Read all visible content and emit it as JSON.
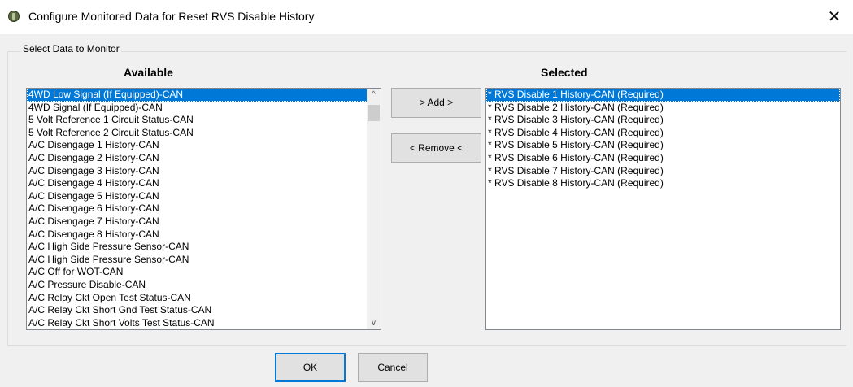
{
  "window": {
    "title": "Configure Monitored Data for Reset RVS Disable History"
  },
  "group_label": "Select Data to Monitor",
  "available": {
    "heading": "Available",
    "items": [
      "4WD Low Signal (If Equipped)-CAN",
      "4WD Signal (If Equipped)-CAN",
      "5 Volt Reference 1 Circuit Status-CAN",
      "5 Volt Reference 2 Circuit Status-CAN",
      "A/C Disengage 1 History-CAN",
      "A/C Disengage 2 History-CAN",
      "A/C Disengage 3 History-CAN",
      "A/C Disengage 4 History-CAN",
      "A/C Disengage 5 History-CAN",
      "A/C Disengage 6 History-CAN",
      "A/C Disengage 7 History-CAN",
      "A/C Disengage 8 History-CAN",
      "A/C High Side Pressure Sensor-CAN",
      "A/C High Side Pressure Sensor-CAN",
      "A/C Off for WOT-CAN",
      "A/C Pressure Disable-CAN",
      "A/C Relay Ckt Open Test Status-CAN",
      "A/C Relay Ckt Short Gnd Test Status-CAN",
      "A/C Relay Ckt Short Volts Test Status-CAN"
    ]
  },
  "selected": {
    "heading": "Selected",
    "items": [
      "* RVS Disable 1 History-CAN (Required)",
      "* RVS Disable 2 History-CAN (Required)",
      "* RVS Disable 3 History-CAN (Required)",
      "* RVS Disable 4 History-CAN (Required)",
      "* RVS Disable 5 History-CAN (Required)",
      "* RVS Disable 6 History-CAN (Required)",
      "* RVS Disable 7 History-CAN (Required)",
      "* RVS Disable 8 History-CAN (Required)"
    ]
  },
  "buttons": {
    "add": "> Add >",
    "remove": "< Remove <",
    "ok": "OK",
    "cancel": "Cancel"
  },
  "icons": {
    "app": "app-logo-icon",
    "close": "close-icon",
    "scroll_up": "chevron-up-icon",
    "scroll_down": "chevron-down-icon"
  },
  "colors": {
    "selection": "#0078d7",
    "default_button_border": "#0078d7",
    "dialog_background": "#f0f0f0"
  }
}
